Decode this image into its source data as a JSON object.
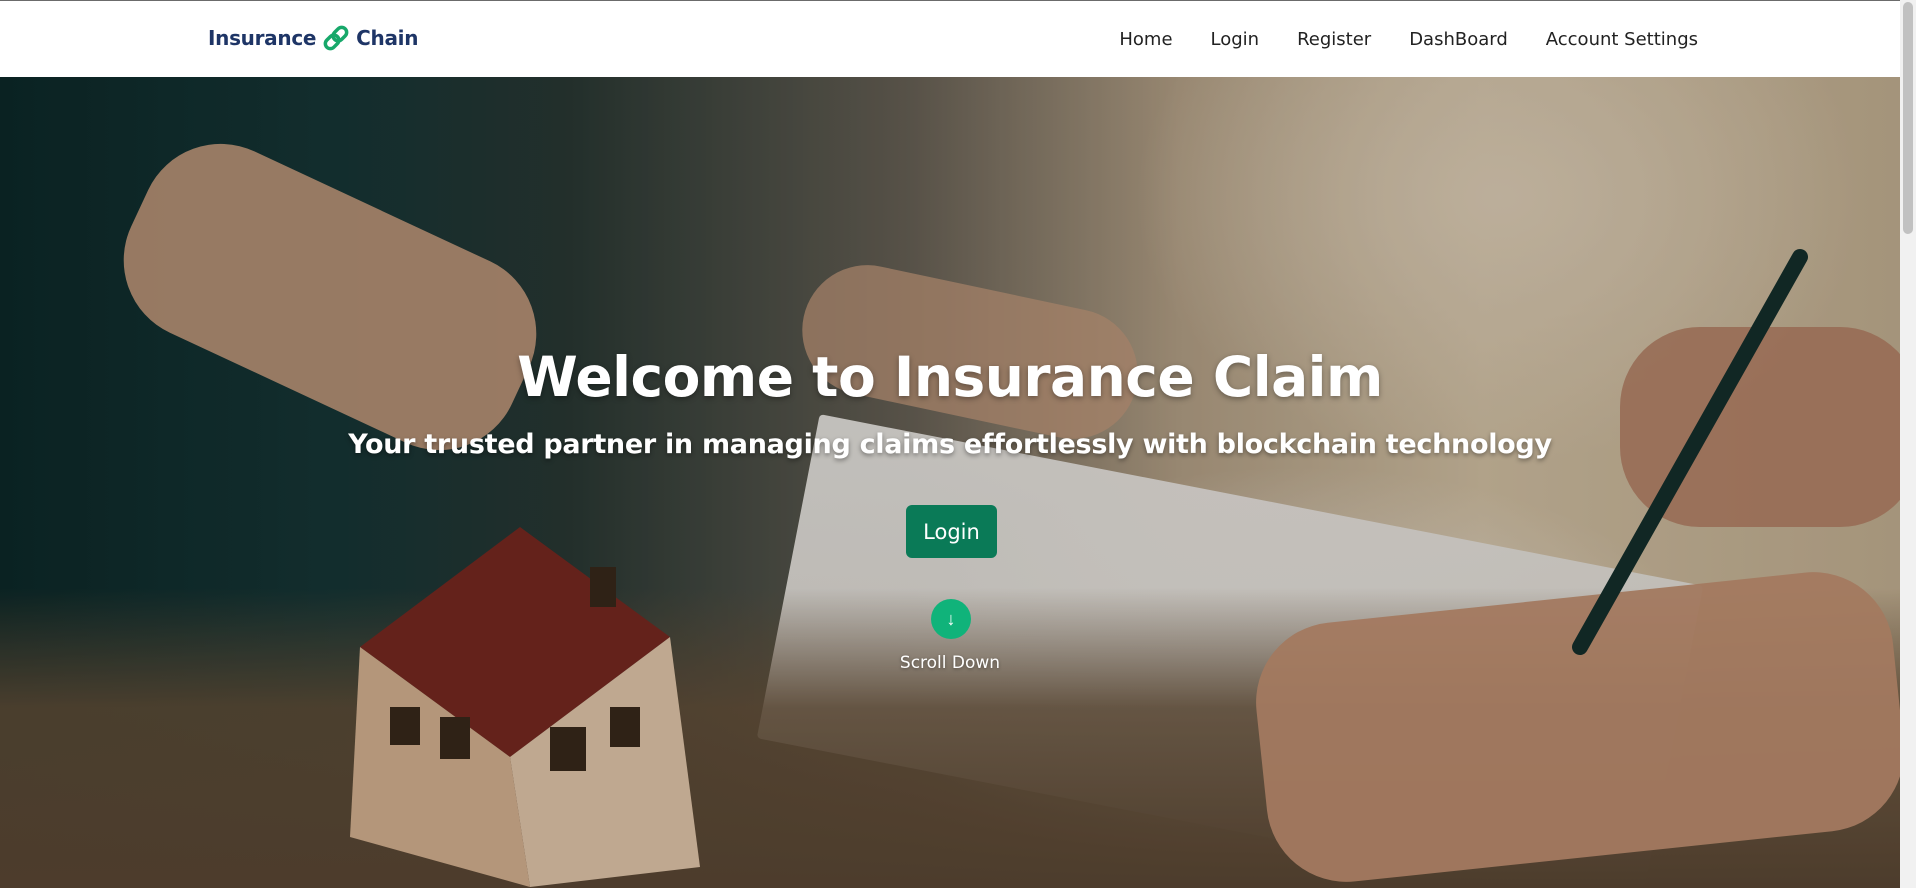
{
  "brand": {
    "name_left": "Insurance",
    "name_right": "Chain",
    "logo_icon": "link-icon",
    "color": "#1e3566",
    "logo_color": "#17a86a"
  },
  "nav": {
    "items": [
      {
        "label": "Home"
      },
      {
        "label": "Login"
      },
      {
        "label": "Register"
      },
      {
        "label": "DashBoard"
      },
      {
        "label": "Account Settings"
      }
    ]
  },
  "hero": {
    "title": "Welcome to Insurance Claim",
    "subtitle": "Your trusted partner in managing claims effortlessly with blockchain technology",
    "login_label": "Login",
    "login_color": "#0a7a57",
    "scroll_icon": "arrow-down-icon",
    "scroll_symbol": "↓",
    "scroll_label": "Scroll Down",
    "scroll_color": "#10b37a",
    "background_image": "house-model-and-insurance-contract-photo"
  }
}
